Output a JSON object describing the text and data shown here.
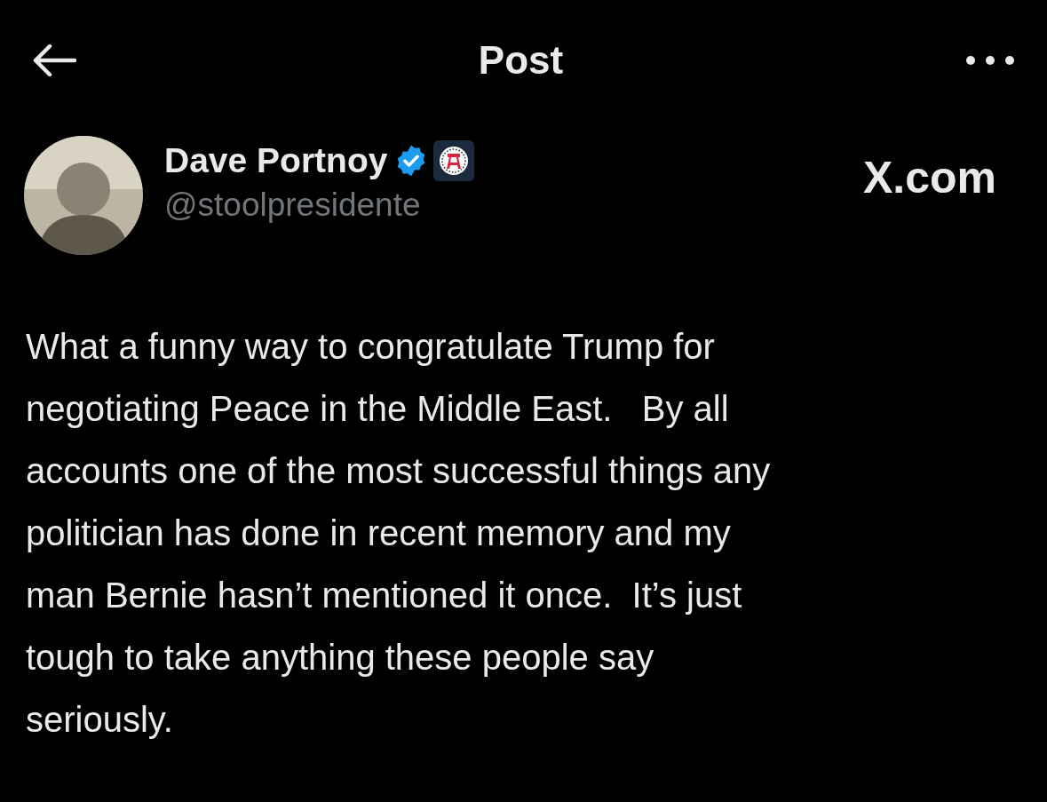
{
  "header": {
    "title": "Post"
  },
  "author": {
    "name": "Dave Portnoy",
    "handle": "@stoolpresidente",
    "verified": true,
    "affiliate_badge": true
  },
  "source_label": "X.com",
  "post": {
    "lines": [
      "What a funny way to congratulate Trump for",
      "negotiating Peace in the Middle East.   By all",
      "accounts one of the most successful things any",
      "politician has done in recent memory and my",
      "man Bernie hasn’t mentioned it once.  It’s just",
      "tough to take anything these people say",
      "seriously."
    ]
  }
}
